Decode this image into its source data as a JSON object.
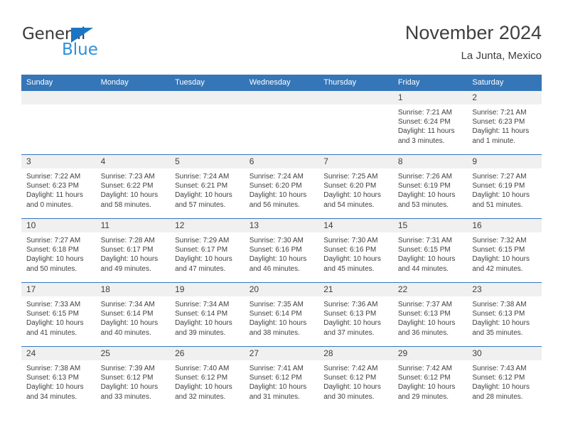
{
  "brand": {
    "name_part1": "General",
    "name_part2": "Blue",
    "color_dark": "#3b3b3b",
    "color_blue": "#2e90d8",
    "triangle_color": "#1a76c4"
  },
  "header": {
    "title": "November 2024",
    "subtitle": "La Junta, Mexico",
    "accent_color": "#3576b8"
  },
  "weekday_headers": [
    "Sunday",
    "Monday",
    "Tuesday",
    "Wednesday",
    "Thursday",
    "Friday",
    "Saturday"
  ],
  "weeks": [
    [
      {
        "day": "",
        "sunrise": "",
        "sunset": "",
        "daylight_line1": "",
        "daylight_line2": "",
        "empty": true
      },
      {
        "day": "",
        "sunrise": "",
        "sunset": "",
        "daylight_line1": "",
        "daylight_line2": "",
        "empty": true
      },
      {
        "day": "",
        "sunrise": "",
        "sunset": "",
        "daylight_line1": "",
        "daylight_line2": "",
        "empty": true
      },
      {
        "day": "",
        "sunrise": "",
        "sunset": "",
        "daylight_line1": "",
        "daylight_line2": "",
        "empty": true
      },
      {
        "day": "",
        "sunrise": "",
        "sunset": "",
        "daylight_line1": "",
        "daylight_line2": "",
        "empty": true
      },
      {
        "day": "1",
        "sunrise": "Sunrise: 7:21 AM",
        "sunset": "Sunset: 6:24 PM",
        "daylight_line1": "Daylight: 11 hours",
        "daylight_line2": "and 3 minutes."
      },
      {
        "day": "2",
        "sunrise": "Sunrise: 7:21 AM",
        "sunset": "Sunset: 6:23 PM",
        "daylight_line1": "Daylight: 11 hours",
        "daylight_line2": "and 1 minute."
      }
    ],
    [
      {
        "day": "3",
        "sunrise": "Sunrise: 7:22 AM",
        "sunset": "Sunset: 6:23 PM",
        "daylight_line1": "Daylight: 11 hours",
        "daylight_line2": "and 0 minutes."
      },
      {
        "day": "4",
        "sunrise": "Sunrise: 7:23 AM",
        "sunset": "Sunset: 6:22 PM",
        "daylight_line1": "Daylight: 10 hours",
        "daylight_line2": "and 58 minutes."
      },
      {
        "day": "5",
        "sunrise": "Sunrise: 7:24 AM",
        "sunset": "Sunset: 6:21 PM",
        "daylight_line1": "Daylight: 10 hours",
        "daylight_line2": "and 57 minutes."
      },
      {
        "day": "6",
        "sunrise": "Sunrise: 7:24 AM",
        "sunset": "Sunset: 6:20 PM",
        "daylight_line1": "Daylight: 10 hours",
        "daylight_line2": "and 56 minutes."
      },
      {
        "day": "7",
        "sunrise": "Sunrise: 7:25 AM",
        "sunset": "Sunset: 6:20 PM",
        "daylight_line1": "Daylight: 10 hours",
        "daylight_line2": "and 54 minutes."
      },
      {
        "day": "8",
        "sunrise": "Sunrise: 7:26 AM",
        "sunset": "Sunset: 6:19 PM",
        "daylight_line1": "Daylight: 10 hours",
        "daylight_line2": "and 53 minutes."
      },
      {
        "day": "9",
        "sunrise": "Sunrise: 7:27 AM",
        "sunset": "Sunset: 6:19 PM",
        "daylight_line1": "Daylight: 10 hours",
        "daylight_line2": "and 51 minutes."
      }
    ],
    [
      {
        "day": "10",
        "sunrise": "Sunrise: 7:27 AM",
        "sunset": "Sunset: 6:18 PM",
        "daylight_line1": "Daylight: 10 hours",
        "daylight_line2": "and 50 minutes."
      },
      {
        "day": "11",
        "sunrise": "Sunrise: 7:28 AM",
        "sunset": "Sunset: 6:17 PM",
        "daylight_line1": "Daylight: 10 hours",
        "daylight_line2": "and 49 minutes."
      },
      {
        "day": "12",
        "sunrise": "Sunrise: 7:29 AM",
        "sunset": "Sunset: 6:17 PM",
        "daylight_line1": "Daylight: 10 hours",
        "daylight_line2": "and 47 minutes."
      },
      {
        "day": "13",
        "sunrise": "Sunrise: 7:30 AM",
        "sunset": "Sunset: 6:16 PM",
        "daylight_line1": "Daylight: 10 hours",
        "daylight_line2": "and 46 minutes."
      },
      {
        "day": "14",
        "sunrise": "Sunrise: 7:30 AM",
        "sunset": "Sunset: 6:16 PM",
        "daylight_line1": "Daylight: 10 hours",
        "daylight_line2": "and 45 minutes."
      },
      {
        "day": "15",
        "sunrise": "Sunrise: 7:31 AM",
        "sunset": "Sunset: 6:15 PM",
        "daylight_line1": "Daylight: 10 hours",
        "daylight_line2": "and 44 minutes."
      },
      {
        "day": "16",
        "sunrise": "Sunrise: 7:32 AM",
        "sunset": "Sunset: 6:15 PM",
        "daylight_line1": "Daylight: 10 hours",
        "daylight_line2": "and 42 minutes."
      }
    ],
    [
      {
        "day": "17",
        "sunrise": "Sunrise: 7:33 AM",
        "sunset": "Sunset: 6:15 PM",
        "daylight_line1": "Daylight: 10 hours",
        "daylight_line2": "and 41 minutes."
      },
      {
        "day": "18",
        "sunrise": "Sunrise: 7:34 AM",
        "sunset": "Sunset: 6:14 PM",
        "daylight_line1": "Daylight: 10 hours",
        "daylight_line2": "and 40 minutes."
      },
      {
        "day": "19",
        "sunrise": "Sunrise: 7:34 AM",
        "sunset": "Sunset: 6:14 PM",
        "daylight_line1": "Daylight: 10 hours",
        "daylight_line2": "and 39 minutes."
      },
      {
        "day": "20",
        "sunrise": "Sunrise: 7:35 AM",
        "sunset": "Sunset: 6:14 PM",
        "daylight_line1": "Daylight: 10 hours",
        "daylight_line2": "and 38 minutes."
      },
      {
        "day": "21",
        "sunrise": "Sunrise: 7:36 AM",
        "sunset": "Sunset: 6:13 PM",
        "daylight_line1": "Daylight: 10 hours",
        "daylight_line2": "and 37 minutes."
      },
      {
        "day": "22",
        "sunrise": "Sunrise: 7:37 AM",
        "sunset": "Sunset: 6:13 PM",
        "daylight_line1": "Daylight: 10 hours",
        "daylight_line2": "and 36 minutes."
      },
      {
        "day": "23",
        "sunrise": "Sunrise: 7:38 AM",
        "sunset": "Sunset: 6:13 PM",
        "daylight_line1": "Daylight: 10 hours",
        "daylight_line2": "and 35 minutes."
      }
    ],
    [
      {
        "day": "24",
        "sunrise": "Sunrise: 7:38 AM",
        "sunset": "Sunset: 6:13 PM",
        "daylight_line1": "Daylight: 10 hours",
        "daylight_line2": "and 34 minutes."
      },
      {
        "day": "25",
        "sunrise": "Sunrise: 7:39 AM",
        "sunset": "Sunset: 6:12 PM",
        "daylight_line1": "Daylight: 10 hours",
        "daylight_line2": "and 33 minutes."
      },
      {
        "day": "26",
        "sunrise": "Sunrise: 7:40 AM",
        "sunset": "Sunset: 6:12 PM",
        "daylight_line1": "Daylight: 10 hours",
        "daylight_line2": "and 32 minutes."
      },
      {
        "day": "27",
        "sunrise": "Sunrise: 7:41 AM",
        "sunset": "Sunset: 6:12 PM",
        "daylight_line1": "Daylight: 10 hours",
        "daylight_line2": "and 31 minutes."
      },
      {
        "day": "28",
        "sunrise": "Sunrise: 7:42 AM",
        "sunset": "Sunset: 6:12 PM",
        "daylight_line1": "Daylight: 10 hours",
        "daylight_line2": "and 30 minutes."
      },
      {
        "day": "29",
        "sunrise": "Sunrise: 7:42 AM",
        "sunset": "Sunset: 6:12 PM",
        "daylight_line1": "Daylight: 10 hours",
        "daylight_line2": "and 29 minutes."
      },
      {
        "day": "30",
        "sunrise": "Sunrise: 7:43 AM",
        "sunset": "Sunset: 6:12 PM",
        "daylight_line1": "Daylight: 10 hours",
        "daylight_line2": "and 28 minutes."
      }
    ]
  ]
}
